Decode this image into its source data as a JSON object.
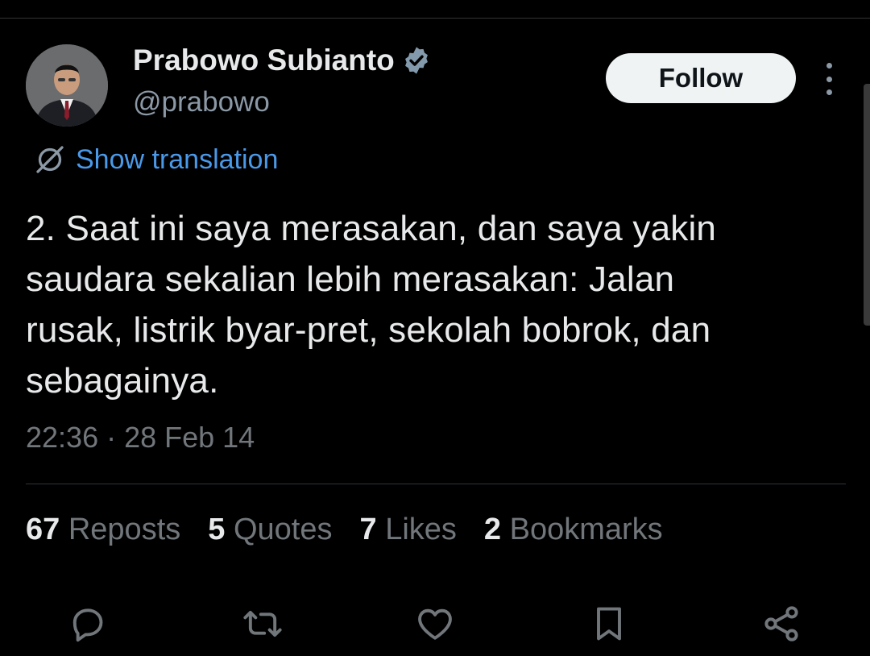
{
  "author": {
    "display_name": "Prabowo Subianto",
    "handle": "@prabowo",
    "verified": true
  },
  "header": {
    "follow_label": "Follow"
  },
  "translation": {
    "label": "Show translation"
  },
  "tweet": {
    "lines": [
      "2. Saat ini saya merasakan, dan saya yakin",
      "saudara sekalian lebih merasakan: Jalan",
      "rusak, listrik byar-pret, sekolah bobrok, dan",
      "sebagainya."
    ],
    "timestamp": "22:36 · 28 Feb 14"
  },
  "stats": {
    "reposts": {
      "count": "67",
      "label": "Reposts"
    },
    "quotes": {
      "count": "5",
      "label": "Quotes"
    },
    "likes": {
      "count": "7",
      "label": "Likes"
    },
    "bookmarks": {
      "count": "2",
      "label": "Bookmarks"
    }
  },
  "actions": [
    "reply-icon",
    "repost-icon",
    "like-icon",
    "bookmark-icon",
    "share-icon"
  ],
  "colors": {
    "background": "#000000",
    "text": "#e7e9ea",
    "secondary": "#71767b",
    "link": "#4a99e9",
    "verified": "#829aab"
  }
}
